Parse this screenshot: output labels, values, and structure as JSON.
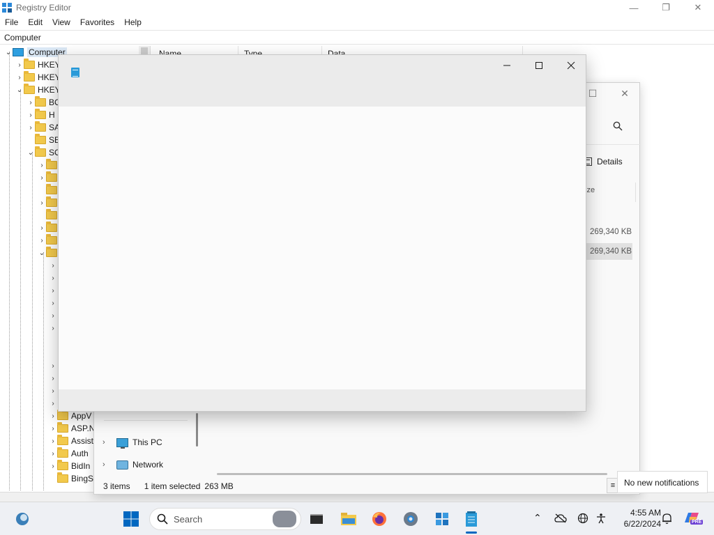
{
  "regedit": {
    "title": "Registry Editor",
    "menu": [
      "File",
      "Edit",
      "View",
      "Favorites",
      "Help"
    ],
    "address": "Computer",
    "columns": [
      "Name",
      "Type",
      "Data"
    ],
    "tree": [
      {
        "label": "Computer",
        "arrow": "⌄",
        "icon": "computer-icon"
      },
      {
        "label": "HKEY",
        "arrow": "›",
        "icon": "folder-icon"
      },
      {
        "label": "HKEY",
        "arrow": "›",
        "icon": "folder-icon"
      },
      {
        "label": "HKEY",
        "arrow": "⌄",
        "icon": "folder-icon"
      },
      {
        "label": "BC",
        "arrow": "›",
        "icon": "folder-icon"
      },
      {
        "label": "H",
        "arrow": "›",
        "icon": "folder-icon"
      },
      {
        "label": "SA",
        "arrow": "›",
        "icon": "folder-icon"
      },
      {
        "label": "SE",
        "arrow": "",
        "icon": "folder-icon"
      },
      {
        "label": "SO",
        "arrow": "⌄",
        "icon": "folder-icon"
      },
      {
        "label": "AppV",
        "arrow": "›",
        "icon": "folder-icon"
      },
      {
        "label": "ASP.N",
        "arrow": "›",
        "icon": "folder-icon"
      },
      {
        "label": "Assist",
        "arrow": "›",
        "icon": "folder-icon"
      },
      {
        "label": "Auth",
        "arrow": "›",
        "icon": "folder-icon"
      },
      {
        "label": "BidIn",
        "arrow": "›",
        "icon": "folder-icon"
      },
      {
        "label": "BingS",
        "arrow": "",
        "icon": "folder-icon"
      }
    ]
  },
  "explorer": {
    "details_label": "Details",
    "size_header": "ize",
    "rows": [
      {
        "size": "269,340 KB",
        "selected": false
      },
      {
        "size": "269,340 KB",
        "selected": true
      }
    ],
    "nav": [
      {
        "label": "This PC",
        "icon": "this-pc-icon"
      },
      {
        "label": "Network",
        "icon": "network-icon"
      }
    ],
    "status": {
      "items": "3 items",
      "selected": "1 item selected",
      "size": "263 MB"
    }
  },
  "notepad": {
    "title": ""
  },
  "notification": {
    "text": "No new notifications"
  },
  "taskbar": {
    "search_label": "Search",
    "time": "4:55 AM",
    "date": "6/22/2024",
    "apps": [
      "widgets-icon",
      "start-icon",
      "search-icon",
      "terminal-icon",
      "file-explorer-icon",
      "firefox-icon",
      "settings-icon",
      "registry-editor-icon",
      "notepad-icon"
    ],
    "tray": [
      "chevron-up-icon",
      "cloud-offline-icon",
      "language-icon",
      "accessibility-icon",
      "bell-icon",
      "copilot-icon"
    ],
    "copilot_badge": "PRE"
  },
  "colors": {
    "accent": "#0067c0",
    "folder": "#f2c94c",
    "titlebar_inactive": "#ebebeb"
  }
}
